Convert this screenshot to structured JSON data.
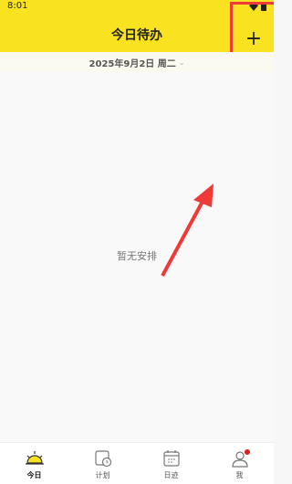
{
  "status_bar": {
    "time": "8:01"
  },
  "header": {
    "title": "今日待办",
    "add_label": "+"
  },
  "date_bar": {
    "date": "2025年9月2日 周二",
    "chevron": "⌄"
  },
  "main": {
    "empty_text": "暂无安排"
  },
  "tabs": [
    {
      "label": "今日",
      "icon": "sun-icon",
      "active": true
    },
    {
      "label": "计划",
      "icon": "calendar-clock-icon",
      "active": false
    },
    {
      "label": "日迹",
      "icon": "calendar-icon",
      "active": false
    },
    {
      "label": "我",
      "icon": "user-icon",
      "active": false,
      "badge": true
    }
  ],
  "colors": {
    "accent": "#f9e21f",
    "highlight": "#ee3b39",
    "badge": "#e02020"
  }
}
